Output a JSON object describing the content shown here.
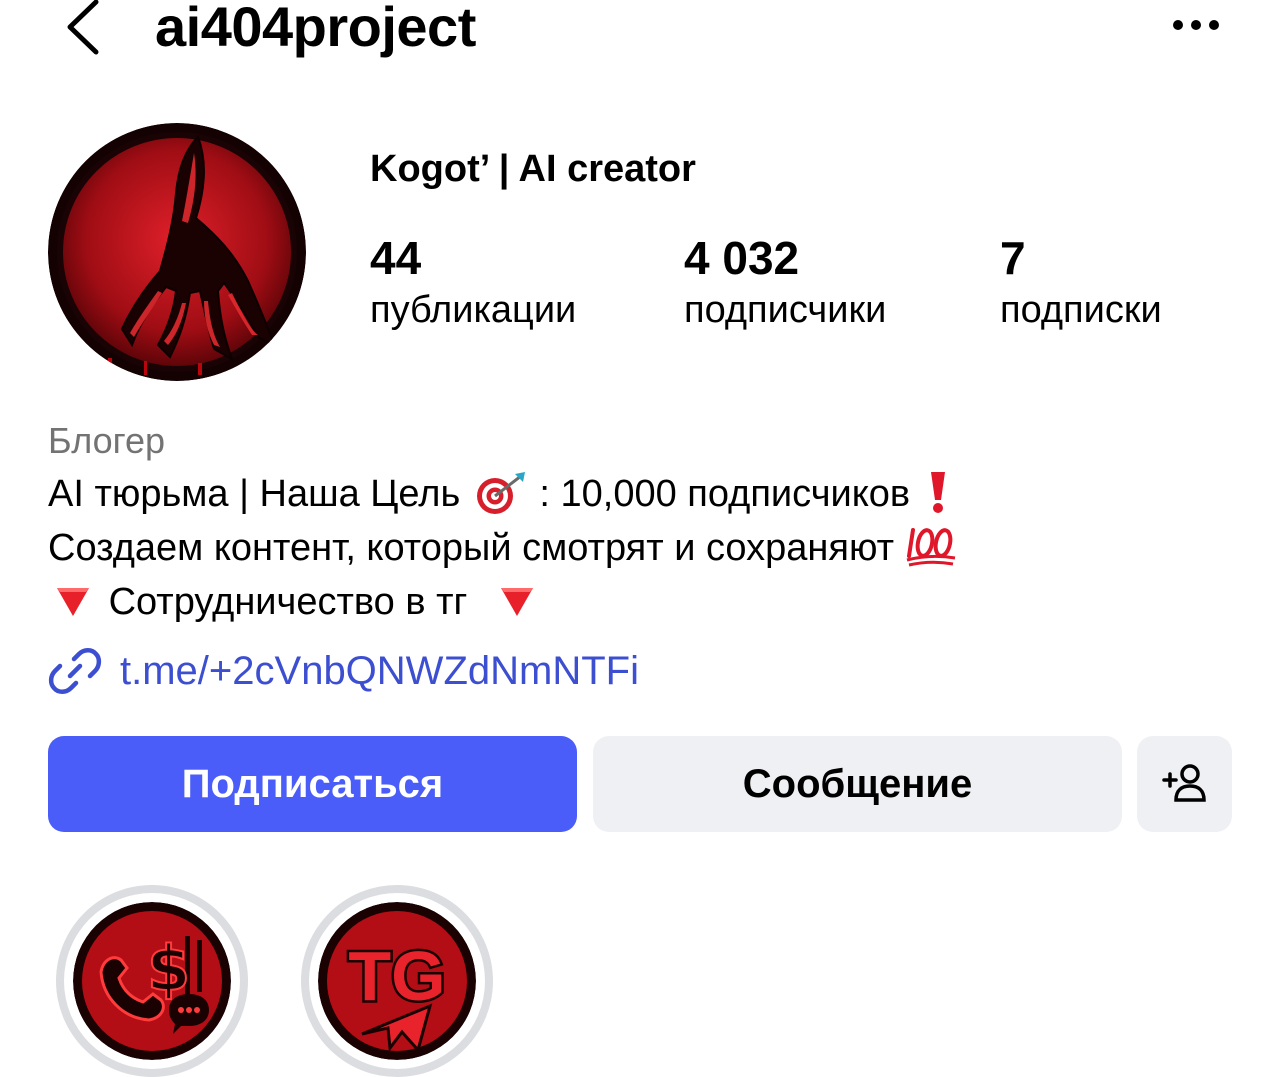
{
  "header": {
    "username": "ai404project",
    "back_icon": "chevron-left-icon",
    "more_icon": "more-horizontal-icon"
  },
  "profile": {
    "display_name": "Kogot’ | AI creator",
    "avatar_icon": "red-claw-avatar",
    "stats": [
      {
        "value": "44",
        "label": "публикации"
      },
      {
        "value": "4 032",
        "label": "подписчики"
      },
      {
        "value": "7",
        "label": "подписки"
      }
    ]
  },
  "bio": {
    "category": "Блогер",
    "line1_a": "AI тюрьма | Наша Цель",
    "line1_b": ": 10,000 подписчиков",
    "line2": "Создаем контент, который смотрят и сохраняют",
    "line3": "Сотрудничество в тг",
    "link": "t.me/+2cVnbQNWZdNmNTFi",
    "emoji": [
      "target-emoji",
      "exclamation-emoji",
      "hundred-points-emoji",
      "red-triangle-down-emoji"
    ]
  },
  "actions": {
    "follow_label": "Подписаться",
    "message_label": "Сообщение",
    "add_person_icon": "add-person-icon"
  },
  "highlights": [
    {
      "icon": "phone-dollar-chat-highlight"
    },
    {
      "text": "TG",
      "icon": "telegram-highlight"
    }
  ],
  "colors": {
    "accent": "#4a5df9",
    "link": "#3d4fd1",
    "secondary_text": "#737373",
    "button_bg": "#eff0f3",
    "avatar_red": "#c0101b"
  }
}
